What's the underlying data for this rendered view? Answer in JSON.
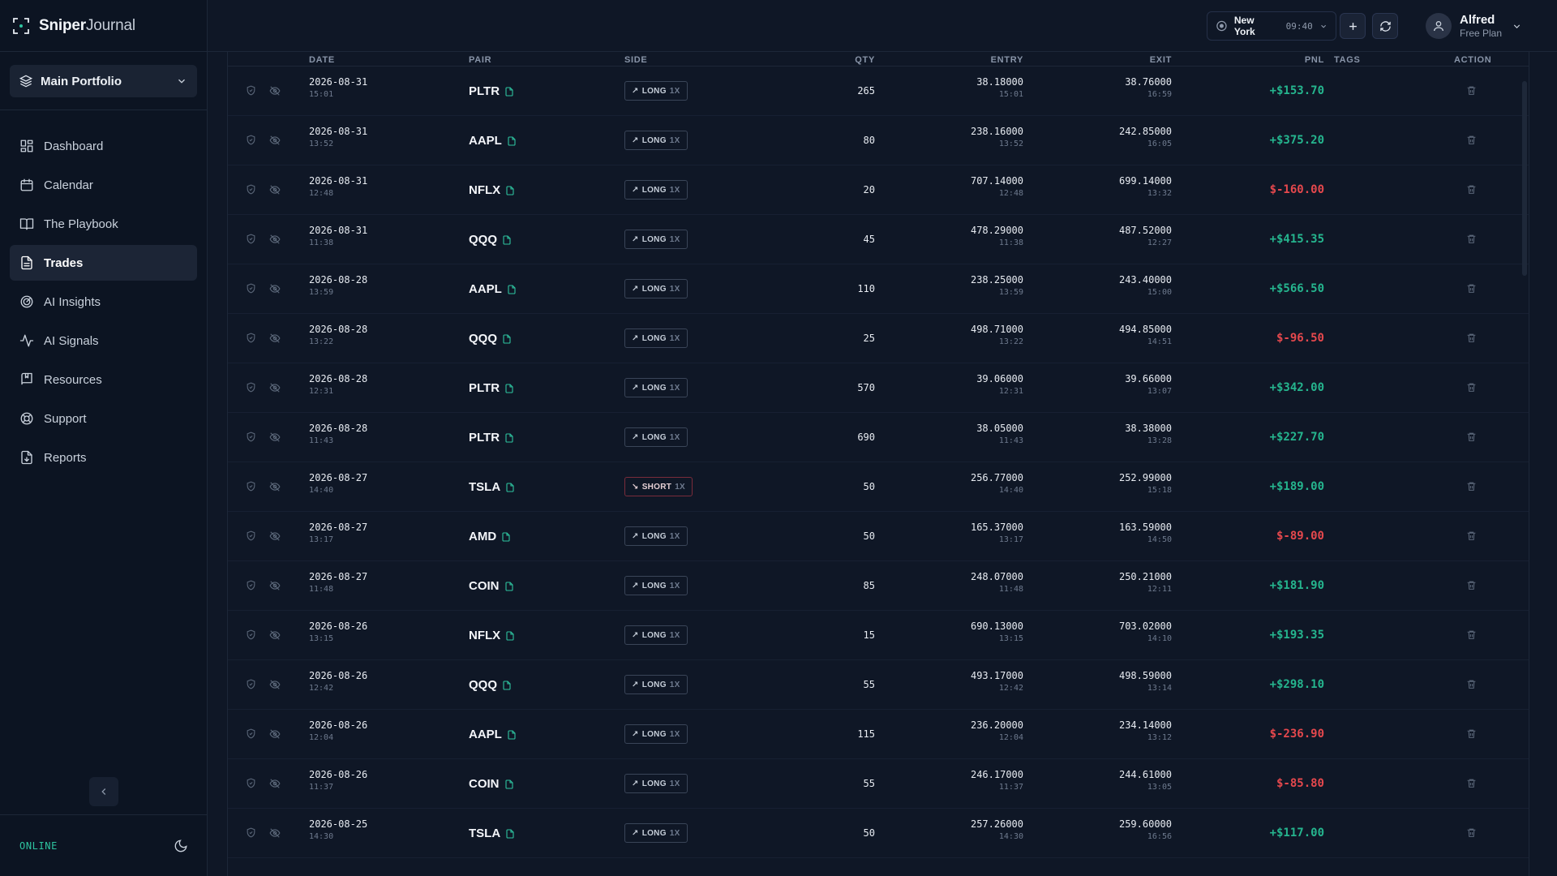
{
  "brand": {
    "name_bold": "Sniper",
    "name_light": "Journal"
  },
  "portfolio": {
    "label": "Main Portfolio"
  },
  "nav": [
    {
      "label": "Dashboard",
      "icon": "dashboard-icon",
      "active": false
    },
    {
      "label": "Calendar",
      "icon": "calendar-icon",
      "active": false
    },
    {
      "label": "The Playbook",
      "icon": "book-icon",
      "active": false
    },
    {
      "label": "Trades",
      "icon": "document-icon",
      "active": true
    },
    {
      "label": "AI Insights",
      "icon": "radar-icon",
      "active": false
    },
    {
      "label": "AI Signals",
      "icon": "activity-icon",
      "active": false
    },
    {
      "label": "Resources",
      "icon": "bookmark-book-icon",
      "active": false
    },
    {
      "label": "Support",
      "icon": "lifebuoy-icon",
      "active": false
    },
    {
      "label": "Reports",
      "icon": "report-icon",
      "active": false
    }
  ],
  "status": {
    "online": "ONLINE"
  },
  "header": {
    "clock": {
      "city": "New York",
      "time": "09:40"
    },
    "user": {
      "name": "Alfred",
      "plan": "Free Plan"
    }
  },
  "table": {
    "columns": {
      "date": "DATE",
      "pair": "PAIR",
      "side": "SIDE",
      "qty": "QTY",
      "entry": "ENTRY",
      "exit": "EXIT",
      "pnl": "PNL",
      "tags": "TAGS",
      "action": "ACTION"
    },
    "rows": [
      {
        "date": "2026-08-31",
        "time": "15:01",
        "pair": "PLTR",
        "side": "LONG",
        "lev": "1X",
        "qty": "265",
        "entry": "38.18000",
        "entry_time": "15:01",
        "exit": "38.76000",
        "exit_time": "16:59",
        "pnl": "+$153.70",
        "positive": true
      },
      {
        "date": "2026-08-31",
        "time": "13:52",
        "pair": "AAPL",
        "side": "LONG",
        "lev": "1X",
        "qty": "80",
        "entry": "238.16000",
        "entry_time": "13:52",
        "exit": "242.85000",
        "exit_time": "16:05",
        "pnl": "+$375.20",
        "positive": true
      },
      {
        "date": "2026-08-31",
        "time": "12:48",
        "pair": "NFLX",
        "side": "LONG",
        "lev": "1X",
        "qty": "20",
        "entry": "707.14000",
        "entry_time": "12:48",
        "exit": "699.14000",
        "exit_time": "13:32",
        "pnl": "$-160.00",
        "positive": false
      },
      {
        "date": "2026-08-31",
        "time": "11:38",
        "pair": "QQQ",
        "side": "LONG",
        "lev": "1X",
        "qty": "45",
        "entry": "478.29000",
        "entry_time": "11:38",
        "exit": "487.52000",
        "exit_time": "12:27",
        "pnl": "+$415.35",
        "positive": true
      },
      {
        "date": "2026-08-28",
        "time": "13:59",
        "pair": "AAPL",
        "side": "LONG",
        "lev": "1X",
        "qty": "110",
        "entry": "238.25000",
        "entry_time": "13:59",
        "exit": "243.40000",
        "exit_time": "15:00",
        "pnl": "+$566.50",
        "positive": true
      },
      {
        "date": "2026-08-28",
        "time": "13:22",
        "pair": "QQQ",
        "side": "LONG",
        "lev": "1X",
        "qty": "25",
        "entry": "498.71000",
        "entry_time": "13:22",
        "exit": "494.85000",
        "exit_time": "14:51",
        "pnl": "$-96.50",
        "positive": false
      },
      {
        "date": "2026-08-28",
        "time": "12:31",
        "pair": "PLTR",
        "side": "LONG",
        "lev": "1X",
        "qty": "570",
        "entry": "39.06000",
        "entry_time": "12:31",
        "exit": "39.66000",
        "exit_time": "13:07",
        "pnl": "+$342.00",
        "positive": true
      },
      {
        "date": "2026-08-28",
        "time": "11:43",
        "pair": "PLTR",
        "side": "LONG",
        "lev": "1X",
        "qty": "690",
        "entry": "38.05000",
        "entry_time": "11:43",
        "exit": "38.38000",
        "exit_time": "13:28",
        "pnl": "+$227.70",
        "positive": true
      },
      {
        "date": "2026-08-27",
        "time": "14:40",
        "pair": "TSLA",
        "side": "SHORT",
        "lev": "1X",
        "qty": "50",
        "entry": "256.77000",
        "entry_time": "14:40",
        "exit": "252.99000",
        "exit_time": "15:18",
        "pnl": "+$189.00",
        "positive": true
      },
      {
        "date": "2026-08-27",
        "time": "13:17",
        "pair": "AMD",
        "side": "LONG",
        "lev": "1X",
        "qty": "50",
        "entry": "165.37000",
        "entry_time": "13:17",
        "exit": "163.59000",
        "exit_time": "14:50",
        "pnl": "$-89.00",
        "positive": false
      },
      {
        "date": "2026-08-27",
        "time": "11:48",
        "pair": "COIN",
        "side": "LONG",
        "lev": "1X",
        "qty": "85",
        "entry": "248.07000",
        "entry_time": "11:48",
        "exit": "250.21000",
        "exit_time": "12:11",
        "pnl": "+$181.90",
        "positive": true
      },
      {
        "date": "2026-08-26",
        "time": "13:15",
        "pair": "NFLX",
        "side": "LONG",
        "lev": "1X",
        "qty": "15",
        "entry": "690.13000",
        "entry_time": "13:15",
        "exit": "703.02000",
        "exit_time": "14:10",
        "pnl": "+$193.35",
        "positive": true
      },
      {
        "date": "2026-08-26",
        "time": "12:42",
        "pair": "QQQ",
        "side": "LONG",
        "lev": "1X",
        "qty": "55",
        "entry": "493.17000",
        "entry_time": "12:42",
        "exit": "498.59000",
        "exit_time": "13:14",
        "pnl": "+$298.10",
        "positive": true
      },
      {
        "date": "2026-08-26",
        "time": "12:04",
        "pair": "AAPL",
        "side": "LONG",
        "lev": "1X",
        "qty": "115",
        "entry": "236.20000",
        "entry_time": "12:04",
        "exit": "234.14000",
        "exit_time": "13:12",
        "pnl": "$-236.90",
        "positive": false
      },
      {
        "date": "2026-08-26",
        "time": "11:37",
        "pair": "COIN",
        "side": "LONG",
        "lev": "1X",
        "qty": "55",
        "entry": "246.17000",
        "entry_time": "11:37",
        "exit": "244.61000",
        "exit_time": "13:05",
        "pnl": "$-85.80",
        "positive": false
      },
      {
        "date": "2026-08-25",
        "time": "14:30",
        "pair": "TSLA",
        "side": "LONG",
        "lev": "1X",
        "qty": "50",
        "entry": "257.26000",
        "entry_time": "14:30",
        "exit": "259.60000",
        "exit_time": "16:56",
        "pnl": "+$117.00",
        "positive": true
      }
    ]
  },
  "colors": {
    "accent": "#2ec4a0",
    "positive": "#25b58e",
    "negative": "#e5484d",
    "background": "#0f1726",
    "sidebar": "#0c1422"
  }
}
